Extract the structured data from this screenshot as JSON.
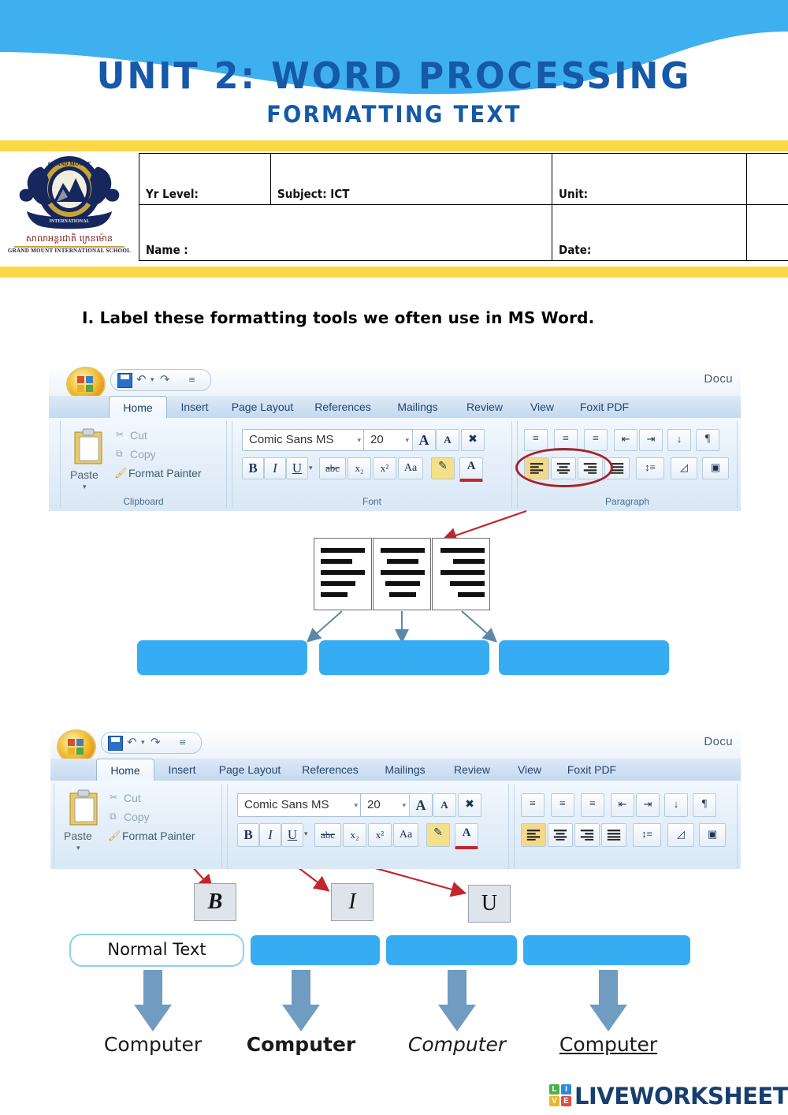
{
  "header": {
    "title": "UNIT 2: WORD PROCESSING",
    "subtitle": "FORMATTING TEXT",
    "wave_color": "#3FB0EF",
    "title_color": "#1559A8",
    "band_color": "#FCD846"
  },
  "logo": {
    "khmer_text": "សាលាអន្តរជាតិ ក្រេនម៉ោន",
    "english_text": "GRAND MOUNT INTERNATIONAL SCHOOL",
    "crest_name": "school-crest"
  },
  "info_table": {
    "row1": {
      "yr_level": "Yr Level:",
      "subject": "Subject:  ICT",
      "unit": "Unit:",
      "extra": "·"
    },
    "row2": {
      "name": "Name :",
      "empty": "",
      "date": "Date:",
      "extra": ""
    }
  },
  "instruction": {
    "q1": "I. Label these formatting tools we often use in MS Word."
  },
  "ribbon": {
    "doc_label": "Docu",
    "tabs": [
      {
        "label": "Home",
        "active": true
      },
      {
        "label": "Insert",
        "active": false
      },
      {
        "label": "Page Layout",
        "active": false
      },
      {
        "label": "References",
        "active": false
      },
      {
        "label": "Mailings",
        "active": false
      },
      {
        "label": "Review",
        "active": false
      },
      {
        "label": "View",
        "active": false
      },
      {
        "label": "Foxit PDF",
        "active": false
      }
    ],
    "clipboard": {
      "group_label": "Clipboard",
      "paste": "Paste",
      "cut": "Cut",
      "copy": "Copy",
      "format_painter": "Format Painter"
    },
    "font": {
      "group_label": "Font",
      "font_name": "Comic Sans MS",
      "font_size": "20",
      "grow": "A",
      "shrink": "A",
      "clear_format": "clear-formatting-icon",
      "bold": "B",
      "italic": "I",
      "underline": "U",
      "strikethrough": "abc",
      "subscript": "x₂",
      "superscript": "x²",
      "change_case": "Aa",
      "highlight": "highlight-icon",
      "font_color": "A"
    },
    "paragraph": {
      "group_label": "Paragraph",
      "bullets": "bullets-icon",
      "numbering": "numbering-icon",
      "multilevel": "multilevel-list-icon",
      "decrease_indent": "decrease-indent-icon",
      "increase_indent": "increase-indent-icon",
      "sort": "sort-icon",
      "show_marks": "¶",
      "align_left": "align-left-icon",
      "align_center": "align-center-icon",
      "align_right": "align-right-icon",
      "justify": "justify-icon",
      "line_spacing": "line-spacing-icon",
      "shading": "shading-icon",
      "borders": "borders-icon"
    },
    "annotation": {
      "ellipse_color": "#A8222A",
      "arrow_color": "#C0272D"
    }
  },
  "alignment_task": {
    "cards": [
      "align-left-sample",
      "align-center-sample",
      "align-right-sample"
    ],
    "answers": [
      "",
      "",
      ""
    ],
    "answer_placeholder": ""
  },
  "biu_task": {
    "buttons": [
      "B",
      "I",
      "U"
    ],
    "first_label": "Normal Text",
    "answers": [
      "",
      "",
      ""
    ],
    "samples": [
      {
        "text": "Computer",
        "style": "normal"
      },
      {
        "text": "Computer",
        "style": "bold"
      },
      {
        "text": "Computer",
        "style": "italic"
      },
      {
        "text": "Computer",
        "style": "underline"
      }
    ]
  },
  "footer": {
    "brand": "LIVEWORKSHEETS",
    "icon_letters": [
      "L",
      "I",
      "V",
      "E"
    ],
    "icon_colors": [
      "#4CAF50",
      "#2E8BD8",
      "#F0B429",
      "#E04C3E"
    ],
    "brand_color": "#173E6E"
  }
}
